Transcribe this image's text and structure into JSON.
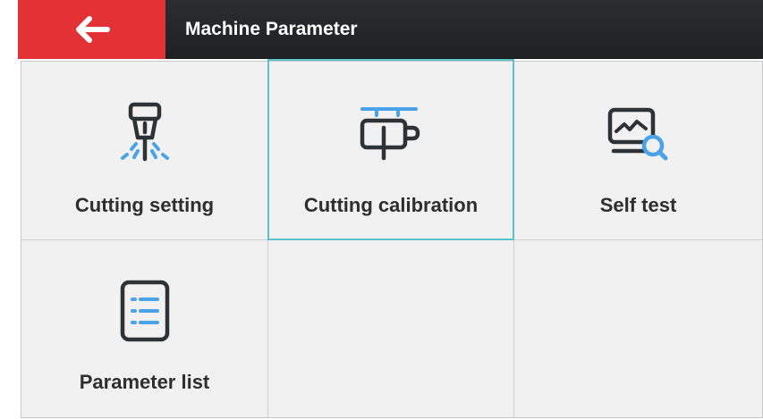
{
  "header": {
    "back_icon": "back-arrow-icon",
    "title": "Machine Parameter"
  },
  "colors": {
    "back_button": "#e23236",
    "header_bg": "#1d2123",
    "selection_border": "#5ac3c9",
    "icon_dark": "#2c3236",
    "icon_accent": "#4aa3e8"
  },
  "tiles": [
    {
      "label": "Cutting setting",
      "icon": "cutting-nozzle-icon",
      "selected": false
    },
    {
      "label": "Cutting calibration",
      "icon": "calibration-icon",
      "selected": true
    },
    {
      "label": "Self test",
      "icon": "monitor-search-icon",
      "selected": false
    },
    {
      "label": "Parameter list",
      "icon": "list-icon",
      "selected": false
    }
  ]
}
